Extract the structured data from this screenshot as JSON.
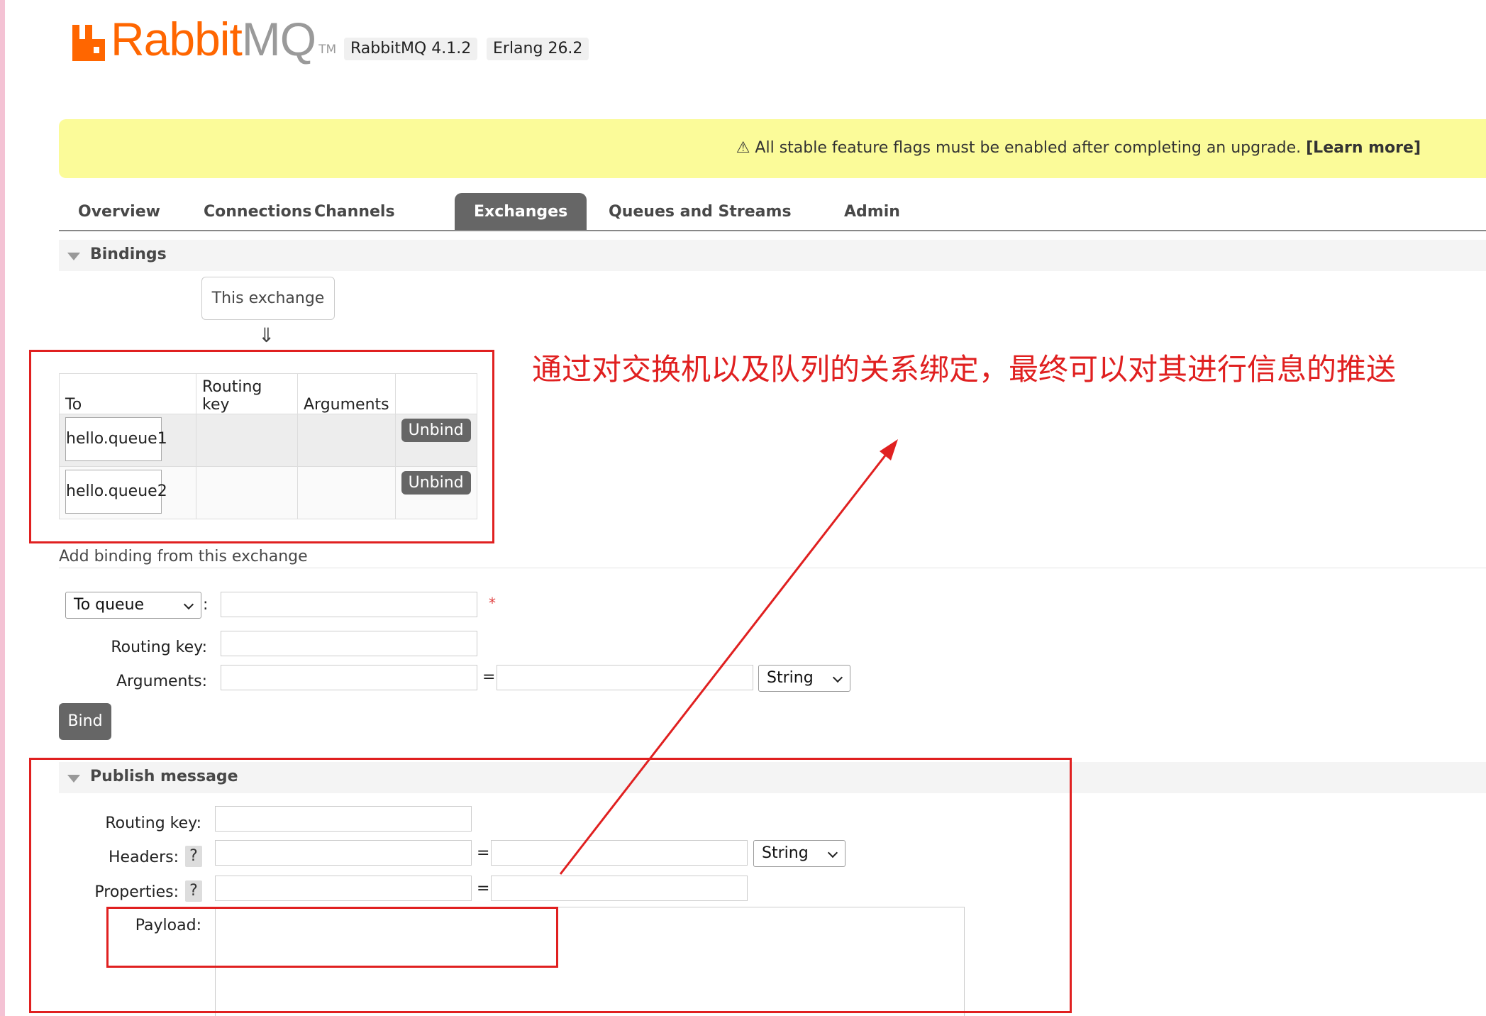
{
  "header": {
    "logo_text_rabbit": "Rabbit",
    "logo_text_mq": "MQ",
    "logo_tm": "TM",
    "version": "RabbitMQ 4.1.2",
    "erlang": "Erlang 26.2"
  },
  "banner": {
    "text": "⚠ All stable feature flags must be enabled after completing an upgrade.",
    "link": "[Learn more]"
  },
  "tabs": [
    {
      "label": "Overview"
    },
    {
      "label": "Connections"
    },
    {
      "label": "Channels"
    },
    {
      "label": "Exchanges",
      "active": true
    },
    {
      "label": "Queues and Streams"
    },
    {
      "label": "Admin"
    }
  ],
  "bindings": {
    "section_title": "Bindings",
    "this_exchange": "This exchange",
    "arrow": "⇓",
    "columns": [
      "To",
      "Routing key",
      "Arguments",
      ""
    ],
    "rows": [
      {
        "to": "hello.queue1",
        "routing_key": "",
        "arguments": "",
        "action": "Unbind"
      },
      {
        "to": "hello.queue2",
        "routing_key": "",
        "arguments": "",
        "action": "Unbind"
      }
    ]
  },
  "add_binding": {
    "title": "Add binding from this exchange",
    "destination_type": "To queue",
    "colon": ":",
    "required_mark": "*",
    "routing_key_label": "Routing key:",
    "arguments_label": "Arguments:",
    "equals": "=",
    "arg_type": "String",
    "bind_button": "Bind"
  },
  "publish": {
    "section_title": "Publish message",
    "routing_key_label": "Routing key:",
    "headers_label": "Headers:",
    "properties_label": "Properties:",
    "payload_label": "Payload:",
    "help": "?",
    "equals": "=",
    "header_type": "String"
  },
  "annotation": {
    "note": "通过对交换机以及队列的关系绑定，最终可以对其进行信息的推送",
    "color": "#e02020"
  },
  "colors": {
    "brand_orange": "#ff6600",
    "banner_yellow": "#fbfb99",
    "active_tab": "#666666"
  }
}
